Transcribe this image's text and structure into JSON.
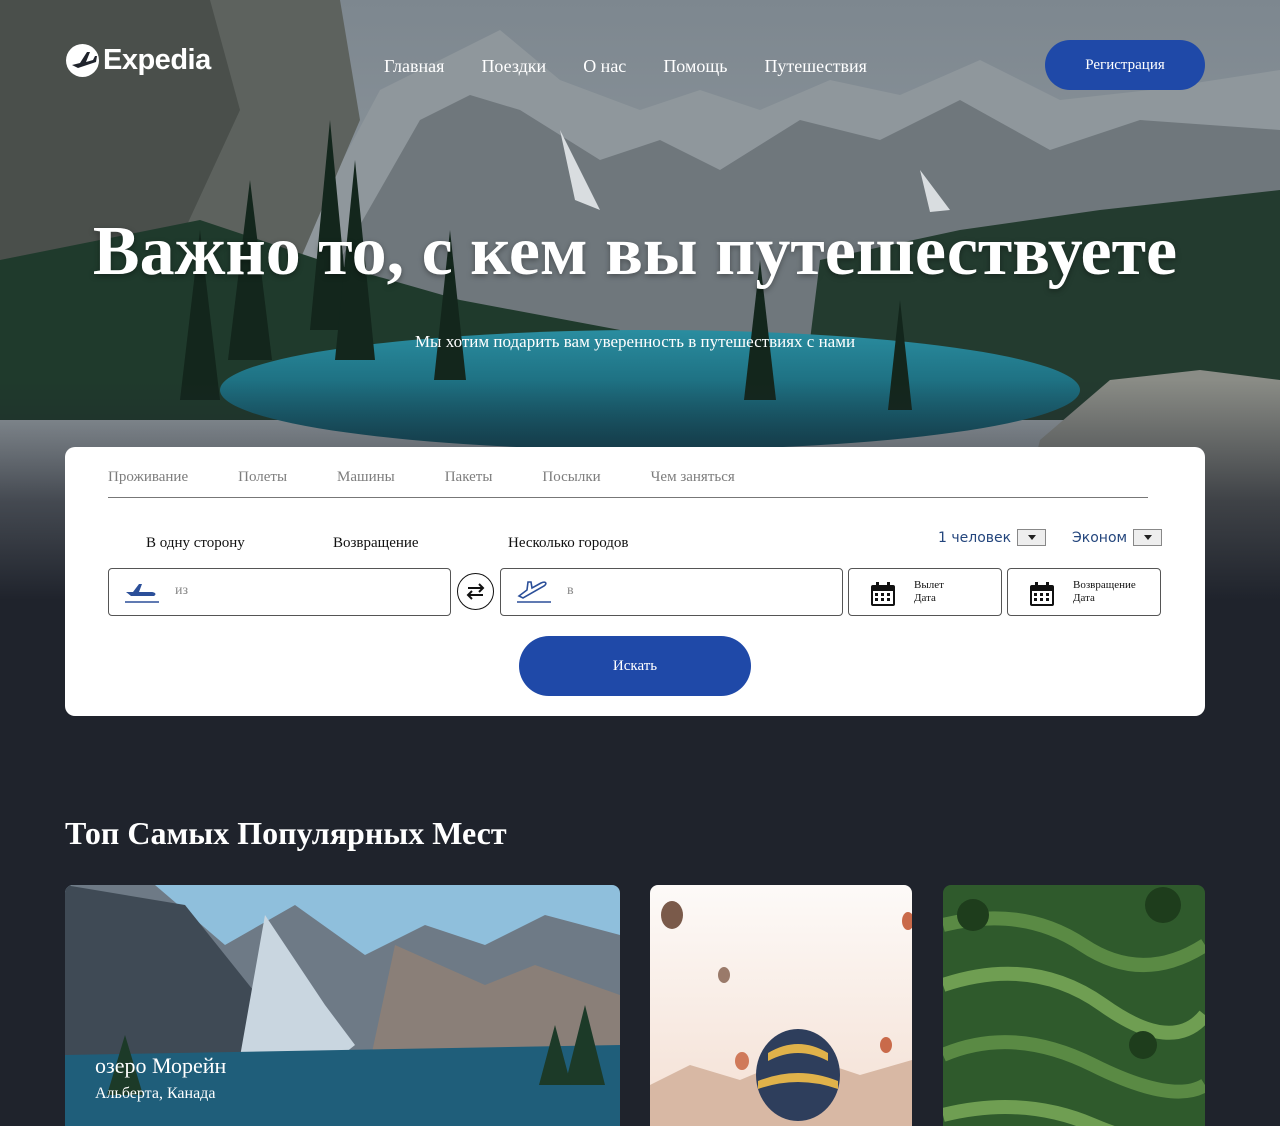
{
  "brand": {
    "name": "Expedia"
  },
  "nav": {
    "items": [
      "Главная",
      "Поездки",
      "О нас",
      "Помощь",
      "Путешествия"
    ],
    "register_label": "Регистрация"
  },
  "hero": {
    "title": "Важно то, с кем вы путешествуете",
    "subtitle": "Мы хотим подарить вам уверенность в путешествиях с нами"
  },
  "search": {
    "tabs": [
      "Проживание",
      "Полеты",
      "Машины",
      "Пакеты",
      "Посылки",
      "Чем заняться"
    ],
    "trip_types": [
      "В одну сторону",
      "Возвращение",
      "Несколько городов"
    ],
    "travelers": "1 человек",
    "cabin_class": "Эконом",
    "from_placeholder": "из",
    "to_placeholder": "в",
    "depart_label_1": "Вылет",
    "depart_label_2": "Дата",
    "return_label_1": "Возвращение",
    "return_label_2": "Дата",
    "search_label": "Искать"
  },
  "popular": {
    "title": "Топ Самых Популярных Мест",
    "destinations": [
      {
        "name": "озеро Морейн",
        "location": "Альберта, Канада"
      },
      {
        "name": "",
        "location": ""
      },
      {
        "name": "",
        "location": ""
      }
    ]
  },
  "colors": {
    "accent": "#1f49a8",
    "background": "#1f232c",
    "card": "#ffffff",
    "select_text": "#24467d"
  }
}
